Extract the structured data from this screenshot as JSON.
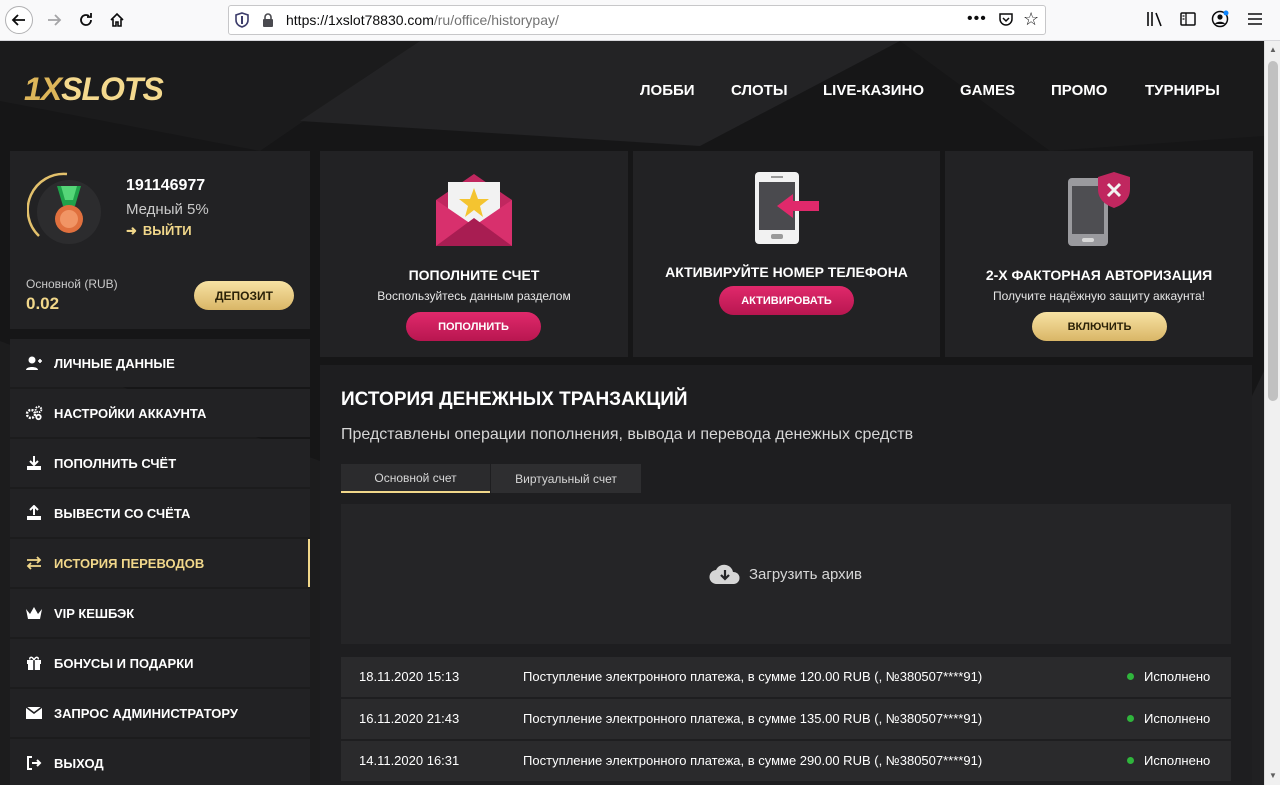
{
  "browser": {
    "url_host": "https://1xslot78830.com",
    "url_path": "/ru/office/historypay/",
    "dots": "•••"
  },
  "header": {
    "logo_one": "1X",
    "logo_rest": "SLOTS",
    "nav": [
      "ЛОББИ",
      "СЛОТЫ",
      "LIVE-КАЗИНО",
      "GAMES",
      "ПРОМО",
      "ТУРНИРЫ"
    ]
  },
  "profile": {
    "user_id": "191146977",
    "level": "Медный 5%",
    "logout": "ВЫЙТИ",
    "balance_label": "Основной (RUB)",
    "balance_value": "0.02",
    "deposit_label": "ДЕПОЗИТ"
  },
  "menu": [
    {
      "label": "ЛИЧНЫЕ ДАННЫЕ",
      "icon": "user-add-icon"
    },
    {
      "label": "НАСТРОЙКИ АККАУНТА",
      "icon": "gears-icon"
    },
    {
      "label": "ПОПОЛНИТЬ СЧЁТ",
      "icon": "download-icon"
    },
    {
      "label": "ВЫВЕСТИ СО СЧЁТА",
      "icon": "upload-icon"
    },
    {
      "label": "ИСТОРИЯ ПЕРЕВОДОВ",
      "icon": "transfer-arrows-icon"
    },
    {
      "label": "VIP КЕШБЭК",
      "icon": "crown-icon"
    },
    {
      "label": "БОНУСЫ И ПОДАРКИ",
      "icon": "gift-icon"
    },
    {
      "label": "ЗАПРОС АДМИНИСТРАТОРУ",
      "icon": "envelope-icon"
    },
    {
      "label": "ВЫХОД",
      "icon": "exit-icon"
    }
  ],
  "promos": [
    {
      "title": "ПОПОЛНИТЕ СЧЕТ",
      "subtitle": "Воспользуйтесь данным разделом",
      "button": "ПОПОЛНИТЬ"
    },
    {
      "title": "АКТИВИРУЙТЕ НОМЕР ТЕЛЕФОНА",
      "subtitle": "",
      "button": "АКТИВИРОВАТЬ"
    },
    {
      "title": "2-Х ФАКТОРНАЯ АВТОРИЗАЦИЯ",
      "subtitle": "Получите надёжную защиту аккаунта!",
      "button": "ВКЛЮЧИТЬ"
    }
  ],
  "history": {
    "title": "ИСТОРИЯ ДЕНЕЖНЫХ ТРАНЗАКЦИЙ",
    "subtitle": "Представлены операции пополнения, вывода и перевода денежных средств",
    "tabs": [
      "Основной счет",
      "Виртуальный счет"
    ],
    "archive": "Загрузить архив",
    "rows": [
      {
        "date": "18.11.2020 15:13",
        "desc": "Поступление электронного платежа, в сумме 120.00 RUB (, №380507****91)",
        "status": "Исполнено"
      },
      {
        "date": "16.11.2020 21:43",
        "desc": "Поступление электронного платежа, в сумме 135.00 RUB (, №380507****91)",
        "status": "Исполнено"
      },
      {
        "date": "14.11.2020 16:31",
        "desc": "Поступление электронного платежа, в сумме 290.00 RUB (, №380507****91)",
        "status": "Исполнено"
      }
    ]
  },
  "colors": {
    "gold": "#f1d78a",
    "pink": "#d41f60",
    "status_green": "#2fb53c"
  }
}
